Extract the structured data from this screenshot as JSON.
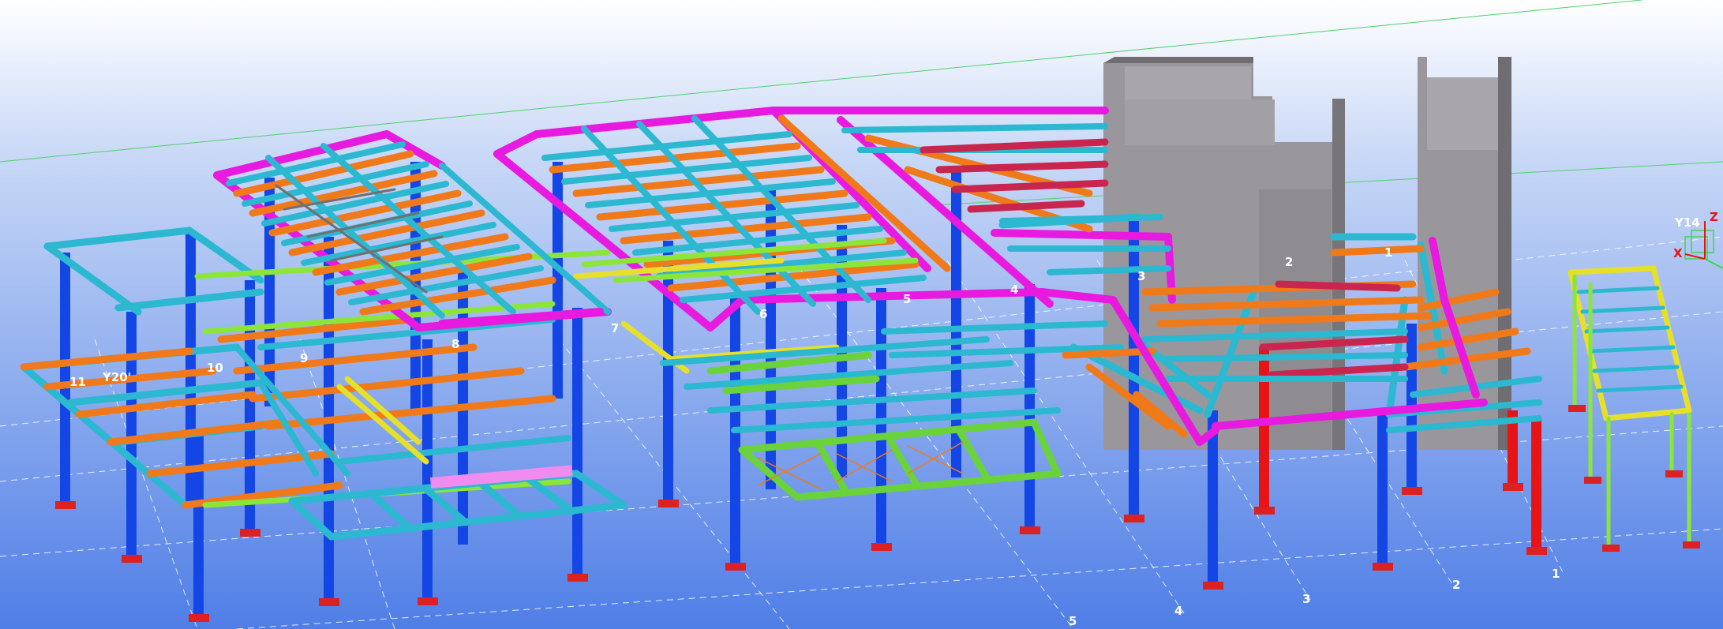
{
  "view": {
    "type": "3D structural model view",
    "colors": {
      "background_top": "#ffffff",
      "background_bottom": "#4f7ee6",
      "column": "#1446e6",
      "column_highlight": "#e61414",
      "beam_cyan": "#2cb8d0",
      "beam_orange": "#f07a1a",
      "beam_magenta": "#e81adf",
      "beam_crimson": "#c8264e",
      "beam_green": "#6ad23a",
      "beam_yellow": "#e6e02a",
      "beam_lime": "#8ce63a",
      "concrete": "#9a979c",
      "support": "#dd2020"
    }
  },
  "grid_labels": {
    "y_axis_numbers": [
      "11",
      "10",
      "9",
      "8",
      "7",
      "6",
      "5",
      "4",
      "3",
      "2",
      "1"
    ],
    "x_axis_numbers": [
      "5",
      "4",
      "3",
      "2",
      "1"
    ],
    "line_labels": [
      "Y20'",
      "Y14"
    ]
  },
  "axis_triad": {
    "z": "Z",
    "x": "X"
  }
}
